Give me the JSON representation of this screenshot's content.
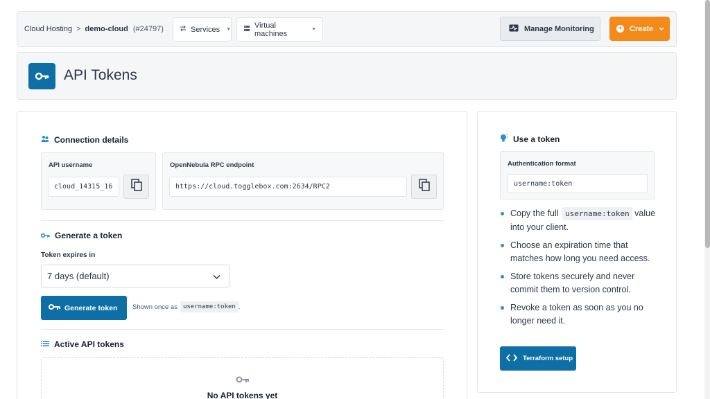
{
  "breadcrumb": {
    "root": "Cloud Hosting",
    "separator": ">",
    "current": "demo-cloud",
    "id": "(#24797)"
  },
  "toolbar": {
    "services_label": "Services",
    "vms_label": "Virtual machines",
    "monitor_label": "Manage Monitoring",
    "create_label": "Create",
    "create_plus": "+"
  },
  "page": {
    "title": "API Tokens"
  },
  "connection": {
    "heading": "Connection details",
    "username_label": "API username",
    "username_value": "cloud_14315_16",
    "endpoint_label": "OpenNebula RPC endpoint",
    "endpoint_value": "https://cloud.togglebox.com:2634/RPC2"
  },
  "generate": {
    "heading": "Generate a token",
    "expires_label": "Token expires in",
    "expires_value": "7 days (default)",
    "button_label": "Generate token",
    "hint_prefix": "Shown once as",
    "hint_code": "username:token",
    "hint_suffix": "."
  },
  "active": {
    "heading": "Active API tokens",
    "empty_text": "No API tokens yet"
  },
  "use_token": {
    "heading": "Use a token",
    "format_label": "Authentication format",
    "format_value": "username:token",
    "tip1_prefix": "Copy the full",
    "tip1_code": "username:token",
    "tip1_suffix": "value into your client.",
    "tip2": "Choose an expiration time that matches how long you need access.",
    "tip3": "Store tokens securely and never commit them to version control.",
    "tip4": "Revoke a token as soon as you no longer need it.",
    "terraform_label": "Terraform setup"
  },
  "colors": {
    "primary": "#0e6fa6",
    "accent_orange": "#f48a1a",
    "bullet": "#2b8fc8"
  },
  "icons": [
    "swap-icon",
    "server-icon",
    "monitor-icon",
    "plus-icon",
    "chevron-down-icon",
    "key-icon",
    "users-icon",
    "copy-icon",
    "list-icon",
    "lightbulb-icon",
    "code-icon"
  ]
}
